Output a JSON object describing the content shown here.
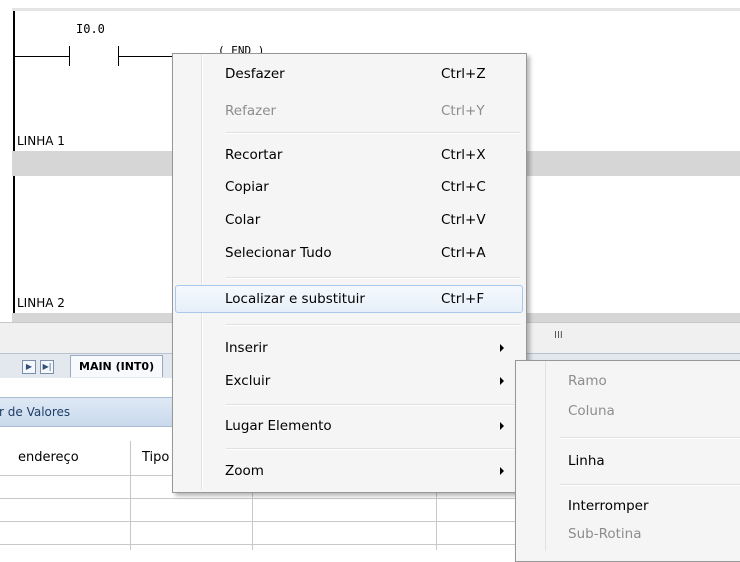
{
  "ladder": {
    "contact_address": "I0.0",
    "coil_text": "( END )",
    "rung_labels": [
      "LINHA 1",
      "LINHA 2"
    ]
  },
  "bottom_panel": {
    "tab_label": "MAIN (INT0)",
    "values_bar_label": "r de Valores",
    "columns": [
      "endereço",
      "Tipo"
    ],
    "scroll_grip": "III"
  },
  "context_menu": {
    "items": [
      {
        "label": "Desfazer",
        "shortcut": "Ctrl+Z",
        "enabled": true
      },
      {
        "label": "Refazer",
        "shortcut": "Ctrl+Y",
        "enabled": false
      },
      {
        "label": "Recortar",
        "shortcut": "Ctrl+X",
        "enabled": true
      },
      {
        "label": "Copiar",
        "shortcut": "Ctrl+C",
        "enabled": true
      },
      {
        "label": "Colar",
        "shortcut": "Ctrl+V",
        "enabled": true
      },
      {
        "label": "Selecionar Tudo",
        "shortcut": "Ctrl+A",
        "enabled": true
      },
      {
        "label": "Localizar e substituir",
        "shortcut": "Ctrl+F",
        "enabled": true,
        "highlighted": true
      },
      {
        "label": "Inserir",
        "submenu": true
      },
      {
        "label": "Excluir",
        "submenu": true
      },
      {
        "label": "Lugar Elemento",
        "submenu": true
      },
      {
        "label": "Zoom",
        "submenu": true
      }
    ]
  },
  "submenu": {
    "items": [
      {
        "label": "Ramo",
        "enabled": false
      },
      {
        "label": "Coluna",
        "enabled": false
      },
      {
        "label": "Linha",
        "enabled": true
      },
      {
        "label": "Interromper",
        "enabled": true
      },
      {
        "label": "Sub-Rotina",
        "enabled": false
      }
    ]
  }
}
